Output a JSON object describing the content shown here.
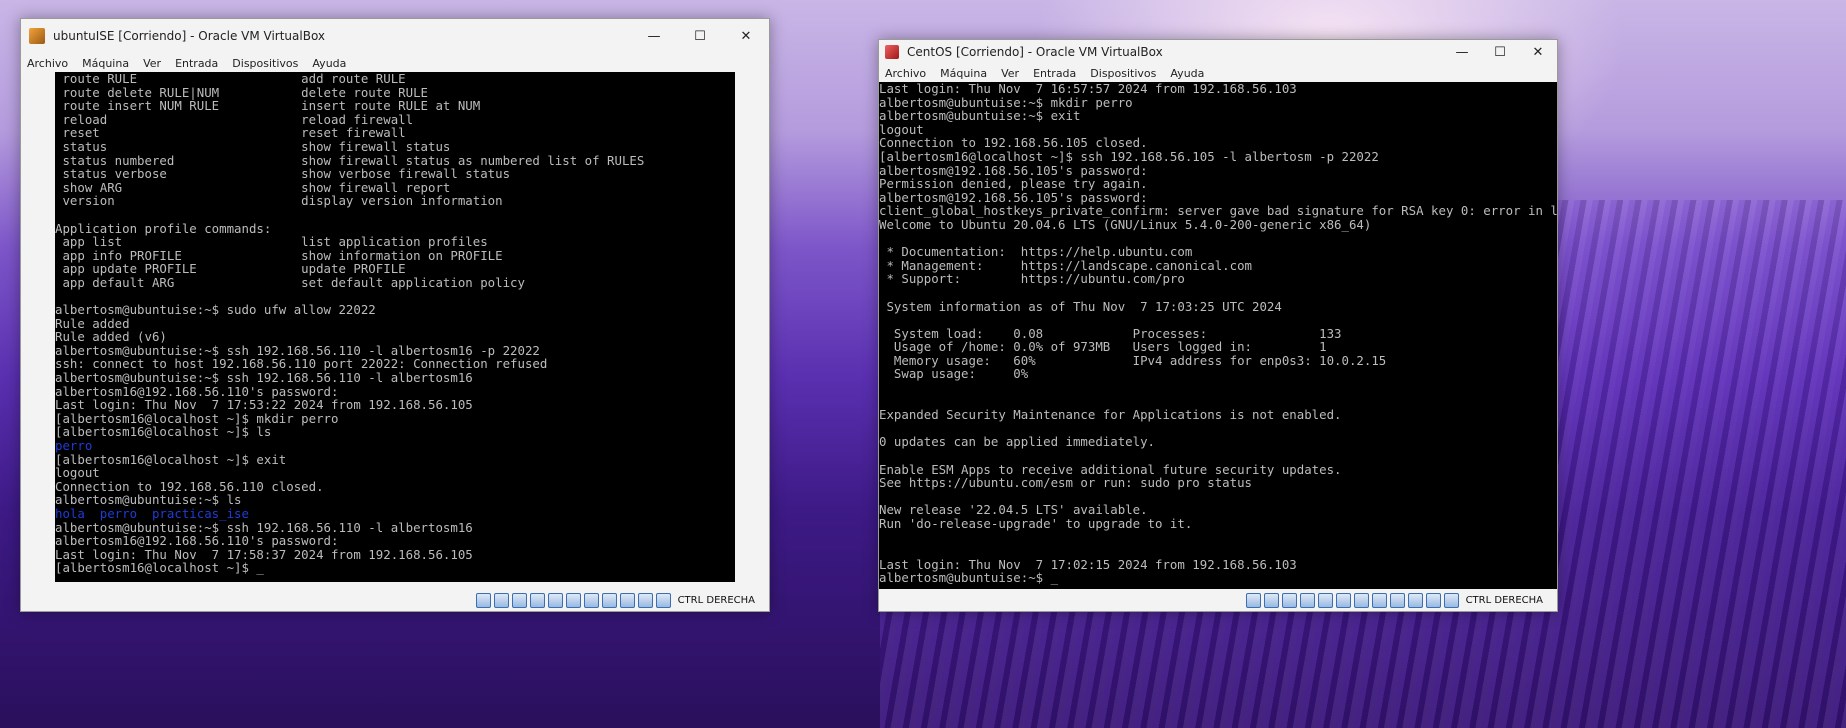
{
  "windows": {
    "left": {
      "title": "ubuntuISE [Corriendo] - Oracle VM VirtualBox",
      "menu": [
        "Archivo",
        "Máquina",
        "Ver",
        "Entrada",
        "Dispositivos",
        "Ayuda"
      ],
      "lines": [
        {
          "t": " route RULE                      add route RULE"
        },
        {
          "t": " route delete RULE|NUM           delete route RULE"
        },
        {
          "t": " route insert NUM RULE           insert route RULE at NUM"
        },
        {
          "t": " reload                          reload firewall"
        },
        {
          "t": " reset                           reset firewall"
        },
        {
          "t": " status                          show firewall status"
        },
        {
          "t": " status numbered                 show firewall status as numbered list of RULES"
        },
        {
          "t": " status verbose                  show verbose firewall status"
        },
        {
          "t": " show ARG                        show firewall report"
        },
        {
          "t": " version                         display version information"
        },
        {
          "t": ""
        },
        {
          "t": "Application profile commands:"
        },
        {
          "t": " app list                        list application profiles"
        },
        {
          "t": " app info PROFILE                show information on PROFILE"
        },
        {
          "t": " app update PROFILE              update PROFILE"
        },
        {
          "t": " app default ARG                 set default application policy"
        },
        {
          "t": ""
        },
        {
          "t": "albertosm@ubuntuise:~$ sudo ufw allow 22022"
        },
        {
          "t": "Rule added"
        },
        {
          "t": "Rule added (v6)"
        },
        {
          "t": "albertosm@ubuntuise:~$ ssh 192.168.56.110 -l albertosm16 -p 22022"
        },
        {
          "t": "ssh: connect to host 192.168.56.110 port 22022: Connection refused"
        },
        {
          "t": "albertosm@ubuntuise:~$ ssh 192.168.56.110 -l albertosm16"
        },
        {
          "t": "albertosm16@192.168.56.110's password:"
        },
        {
          "t": "Last login: Thu Nov  7 17:53:22 2024 from 192.168.56.105"
        },
        {
          "t": "[albertosm16@localhost ~]$ mkdir perro"
        },
        {
          "t": "[albertosm16@localhost ~]$ ls"
        },
        {
          "t": "perro",
          "c": "blue"
        },
        {
          "t": "[albertosm16@localhost ~]$ exit"
        },
        {
          "t": "logout"
        },
        {
          "t": "Connection to 192.168.56.110 closed."
        },
        {
          "t": "albertosm@ubuntuise:~$ ls"
        },
        {
          "t": "hola  perro  practicas_ise",
          "c": "blue"
        },
        {
          "t": "albertosm@ubuntuise:~$ ssh 192.168.56.110 -l albertosm16"
        },
        {
          "t": "albertosm16@192.168.56.110's password:"
        },
        {
          "t": "Last login: Thu Nov  7 17:58:37 2024 from 192.168.56.105"
        },
        {
          "t": "[albertosm16@localhost ~]$ _"
        }
      ],
      "host_key": "CTRL DERECHA"
    },
    "right": {
      "title": "CentOS [Corriendo] - Oracle VM VirtualBox",
      "menu": [
        "Archivo",
        "Máquina",
        "Ver",
        "Entrada",
        "Dispositivos",
        "Ayuda"
      ],
      "lines": [
        {
          "t": "Last login: Thu Nov  7 16:57:57 2024 from 192.168.56.103"
        },
        {
          "t": "albertosm@ubuntuise:~$ mkdir perro"
        },
        {
          "t": "albertosm@ubuntuise:~$ exit"
        },
        {
          "t": "logout"
        },
        {
          "t": "Connection to 192.168.56.105 closed."
        },
        {
          "t": "[albertosm16@localhost ~]$ ssh 192.168.56.105 -l albertosm -p 22022"
        },
        {
          "t": "albertosm@192.168.56.105's password:"
        },
        {
          "t": "Permission denied, please try again."
        },
        {
          "t": "albertosm@192.168.56.105's password:"
        },
        {
          "t": "client_global_hostkeys_private_confirm: server gave bad signature for RSA key 0: error in libcrypto"
        },
        {
          "t": "Welcome to Ubuntu 20.04.6 LTS (GNU/Linux 5.4.0-200-generic x86_64)"
        },
        {
          "t": ""
        },
        {
          "t": " * Documentation:  https://help.ubuntu.com"
        },
        {
          "t": " * Management:     https://landscape.canonical.com"
        },
        {
          "t": " * Support:        https://ubuntu.com/pro"
        },
        {
          "t": ""
        },
        {
          "t": " System information as of Thu Nov  7 17:03:25 UTC 2024"
        },
        {
          "t": ""
        },
        {
          "t": "  System load:    0.08            Processes:               133"
        },
        {
          "t": "  Usage of /home: 0.0% of 973MB   Users logged in:         1"
        },
        {
          "t": "  Memory usage:   60%             IPv4 address for enp0s3: 10.0.2.15"
        },
        {
          "t": "  Swap usage:     0%"
        },
        {
          "t": ""
        },
        {
          "t": ""
        },
        {
          "t": "Expanded Security Maintenance for Applications is not enabled."
        },
        {
          "t": ""
        },
        {
          "t": "0 updates can be applied immediately."
        },
        {
          "t": ""
        },
        {
          "t": "Enable ESM Apps to receive additional future security updates."
        },
        {
          "t": "See https://ubuntu.com/esm or run: sudo pro status"
        },
        {
          "t": ""
        },
        {
          "t": "New release '22.04.5 LTS' available."
        },
        {
          "t": "Run 'do-release-upgrade' to upgrade to it."
        },
        {
          "t": ""
        },
        {
          "t": ""
        },
        {
          "t": "Last login: Thu Nov  7 17:02:15 2024 from 192.168.56.103"
        },
        {
          "t": "albertosm@ubuntuise:~$ _"
        }
      ],
      "host_key": "CTRL DERECHA"
    }
  },
  "colors": {
    "terminal_bg": "#000000",
    "terminal_fg": "#bcbcbc",
    "dir_blue": "#1f3bd6"
  },
  "icons": [
    "virtualbox-icon",
    "minimize-icon",
    "maximize-icon",
    "close-icon",
    "status-icon"
  ]
}
